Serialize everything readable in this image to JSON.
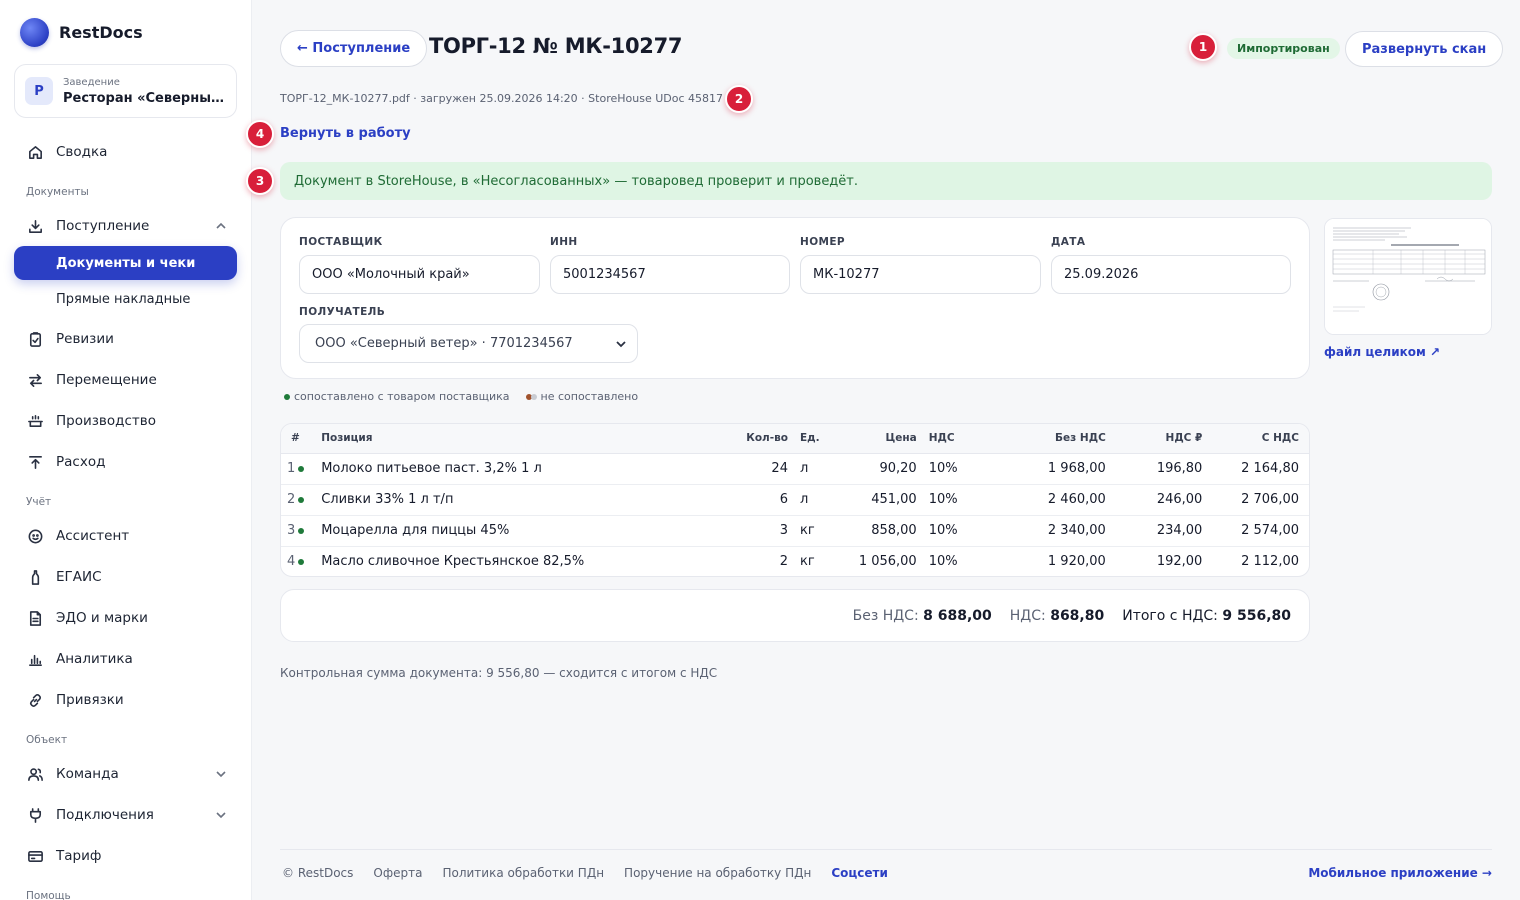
{
  "brand": {
    "name": "RestDocs"
  },
  "venue": {
    "initial": "Р",
    "caption": "Заведение",
    "name": "Ресторан «Северный ветер»"
  },
  "sidebar": {
    "summary": "Сводка",
    "section_docs": "Документы",
    "receipt": "Поступление",
    "docs_and_checks": "Документы и чеки",
    "direct_invoices": "Прямые накладные",
    "audits": "Ревизии",
    "transfer": "Перемещение",
    "production": "Производство",
    "expense": "Расход",
    "section_accounting": "Учёт",
    "assistant": "Ассистент",
    "egais": "ЕГАИС",
    "edo": "ЭДО и марки",
    "analytics": "Аналитика",
    "bindings": "Привязки",
    "section_object": "Объект",
    "team": "Команда",
    "connections": "Подключения",
    "tariff": "Тариф",
    "section_help": "Помощь"
  },
  "header": {
    "back_label": "← Поступление",
    "title": "ТОРГ-12 № МК-10277",
    "status": "Импортирован",
    "expand_label": "Развернуть скан"
  },
  "markers": {
    "m1": "1",
    "m2": "2",
    "m3": "3",
    "m4": "4"
  },
  "meta_line": "ТОРГ-12_МК-10277.pdf · загружен 25.09.2026 14:20 · StoreHouse UDoc 45817",
  "return_label": "Вернуть в работу",
  "notice": "Документ в StoreHouse, в «Несогласованных» — товаровед проверит и проведёт.",
  "form": {
    "supplier_label": "ПОСТАВЩИК",
    "supplier_value": "ООО «Молочный край»",
    "inn_label": "ИНН",
    "inn_value": "5001234567",
    "number_label": "НОМЕР",
    "number_value": "МК-10277",
    "date_label": "ДАТА",
    "date_value": "25.09.2026",
    "recipient_label": "ПОЛУЧАТЕЛЬ",
    "recipient_value": "ООО «Северный ветер» · 7701234567"
  },
  "scan": {
    "link": "файл целиком ↗"
  },
  "legend": {
    "matched": "сопоставлено с товаром поставщика",
    "unmatched": "не сопоставлено",
    "matched_color": "#1f7a3a",
    "unmatched_color": "#a0522d"
  },
  "table": {
    "headers": {
      "num": "#",
      "item": "Позиция",
      "qty": "Кол-во",
      "unit": "Ед.",
      "price": "Цена",
      "vat": "НДС",
      "net": "Без НДС",
      "vat_sum": "НДС ₽",
      "gross": "С НДС"
    },
    "rows": [
      {
        "num": "1",
        "item": "Молоко питьевое паст. 3,2% 1 л",
        "qty": "24",
        "unit": "л",
        "price": "90,20",
        "vat": "10%",
        "net": "1 968,00",
        "vat_sum": "196,80",
        "gross": "2 164,80"
      },
      {
        "num": "2",
        "item": "Сливки 33% 1 л т/п",
        "qty": "6",
        "unit": "л",
        "price": "451,00",
        "vat": "10%",
        "net": "2 460,00",
        "vat_sum": "246,00",
        "gross": "2 706,00"
      },
      {
        "num": "3",
        "item": "Моцарелла для пиццы 45%",
        "qty": "3",
        "unit": "кг",
        "price": "858,00",
        "vat": "10%",
        "net": "2 340,00",
        "vat_sum": "234,00",
        "gross": "2 574,00"
      },
      {
        "num": "4",
        "item": "Масло сливочное Крестьянское 82,5%",
        "qty": "2",
        "unit": "кг",
        "price": "1 056,00",
        "vat": "10%",
        "net": "1 920,00",
        "vat_sum": "192,00",
        "gross": "2 112,00"
      }
    ]
  },
  "totals": {
    "net_label": "Без НДС:",
    "net_value": "8 688,00",
    "vat_label": "НДС:",
    "vat_value": "868,80",
    "gross_label": "Итого с НДС:",
    "gross_value": "9 556,80"
  },
  "checksum": "Контрольная сумма документа: 9 556,80 — сходится с итогом с НДС",
  "footer": {
    "copyright": "© RestDocs",
    "offer": "Оферта",
    "privacy": "Политика обработки ПДн",
    "instruction": "Поручение на обработку ПДн",
    "social": "Соцсети",
    "mobile": "Мобильное приложение →"
  },
  "colors": {
    "accent": "#2b3fc4",
    "success": "#1f6b35",
    "marker": "#d81f3a"
  }
}
